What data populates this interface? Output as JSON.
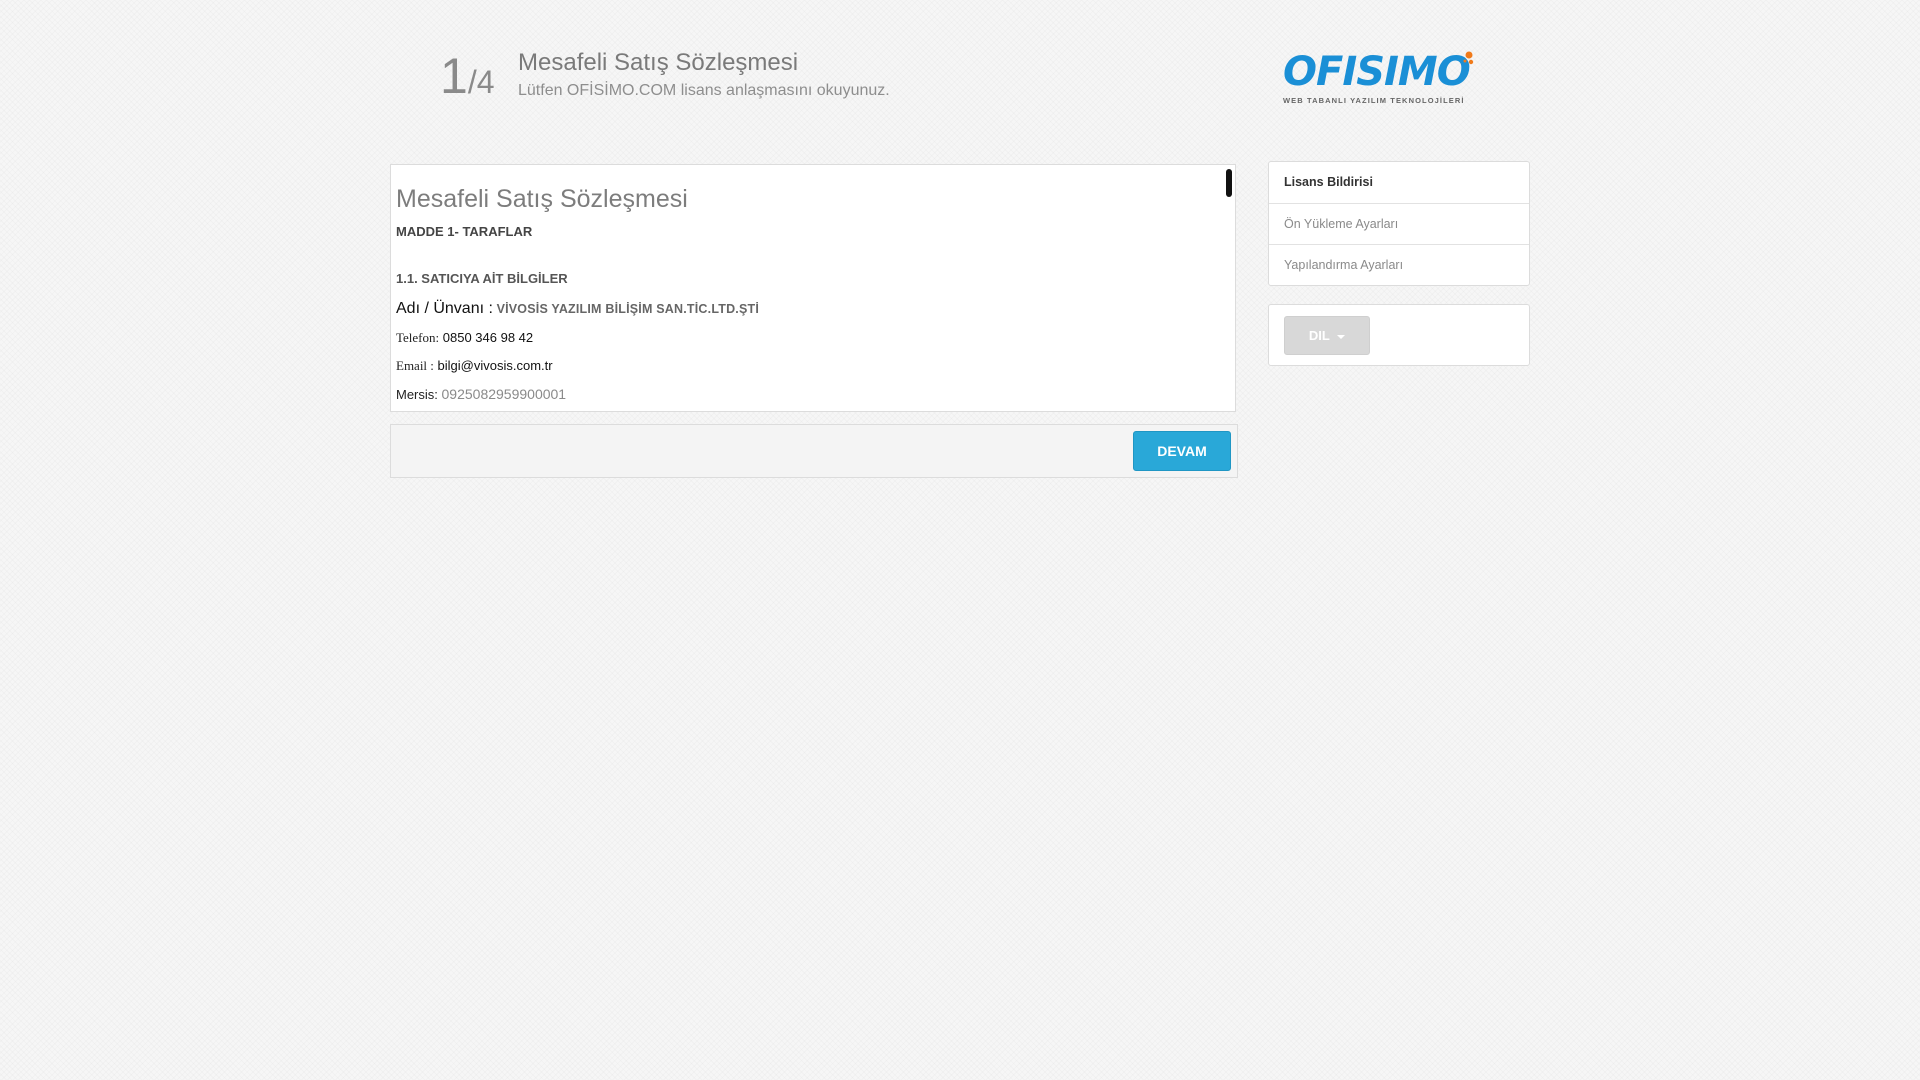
{
  "header": {
    "step_current": "1",
    "step_total": "/4",
    "title": "Mesafeli Satış Sözleşmesi",
    "subtitle": "Lütfen OFİSİMO.COM lisans anlaşmasını okuyunuz."
  },
  "logo": {
    "word": "OFISIMO",
    "tagline": "WEB TABANLI YAZILIM TEKNOLOJİLERİ",
    "colors": {
      "text": "#1a8fd6",
      "accent": "#f07a1a"
    }
  },
  "document": {
    "title": "Mesafeli Satış Sözleşmesi",
    "article": "MADDE 1- TARAFLAR",
    "section": "1.1. SATICIYA AİT BİLGİLER",
    "name_label": "Adı / Ünvanı :",
    "name_value": "VİVOSİS YAZILIM BİLİŞİM SAN.TİC.LTD.ŞTİ",
    "phone_label": "Telefon:",
    "phone_value": "0850 346 98 42",
    "email_label": "Email :",
    "email_value": "bilgi@vivosis.com.tr",
    "mersis_label": "Mersis:",
    "mersis_value": "0925082959900001"
  },
  "footer": {
    "continue_label": "DEVAM"
  },
  "sidebar": {
    "steps": [
      {
        "label": "Lisans Bildirisi",
        "active": true
      },
      {
        "label": "Ön Yükleme Ayarları",
        "active": false
      },
      {
        "label": "Yapılandırma Ayarları",
        "active": false
      }
    ],
    "language_label": "DIL"
  },
  "colors": {
    "primary_button": "#29a8d8",
    "background": "#f6f6f6"
  }
}
